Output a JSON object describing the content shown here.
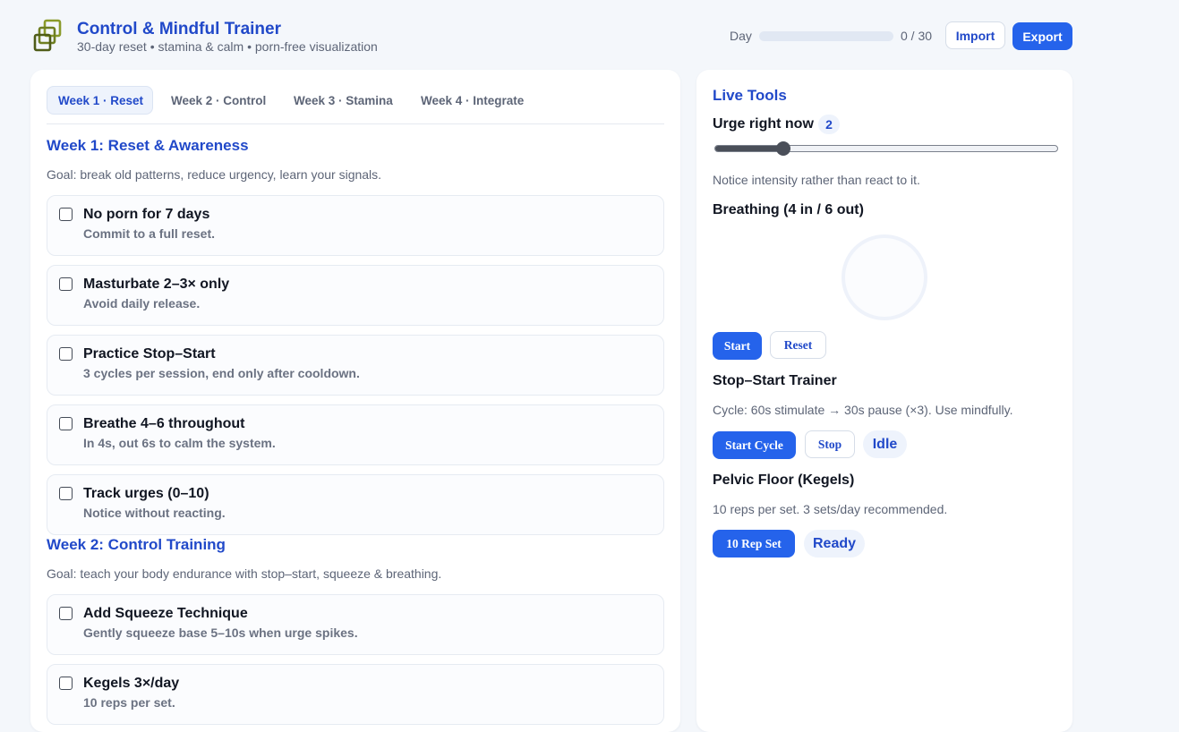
{
  "header": {
    "title": "Control & Mindful Trainer",
    "subtitle": "30-day reset • stamina & calm • porn-free visualization",
    "day_label": "Day",
    "day_count": "0 / 30",
    "day_progress": 0,
    "import_label": "Import",
    "export_label": "Export",
    "logo_icon": "layered-squares-icon"
  },
  "tabs": [
    {
      "label": "Week 1 · Reset",
      "active": true
    },
    {
      "label": "Week 2 · Control",
      "active": false
    },
    {
      "label": "Week 3 · Stamina",
      "active": false
    },
    {
      "label": "Week 4 · Integrate",
      "active": false
    }
  ],
  "weeks": [
    {
      "title": "Week 1: Reset & Awareness",
      "goal": "Goal: break old patterns, reduce urgency, learn your signals.",
      "tasks": [
        {
          "title": "No porn for 7 days",
          "desc": "Commit to a full reset.",
          "checked": false
        },
        {
          "title": "Masturbate 2–3× only",
          "desc": "Avoid daily release.",
          "checked": false
        },
        {
          "title": "Practice Stop–Start",
          "desc": "3 cycles per session, end only after cooldown.",
          "checked": false
        },
        {
          "title": "Breathe 4–6 throughout",
          "desc": "In 4s, out 6s to calm the system.",
          "checked": false
        },
        {
          "title": "Track urges (0–10)",
          "desc": "Notice without reacting.",
          "checked": false
        }
      ]
    },
    {
      "title": "Week 2: Control Training",
      "goal": "Goal: teach your body endurance with stop–start, squeeze & breathing.",
      "tasks": [
        {
          "title": "Add Squeeze Technique",
          "desc": "Gently squeeze base 5–10s when urge spikes.",
          "checked": false
        },
        {
          "title": "Kegels 3×/day",
          "desc": "10 reps per set.",
          "checked": false
        }
      ]
    }
  ],
  "tools": {
    "title": "Live Tools",
    "urge": {
      "label": "Urge right now",
      "value": "2",
      "slider_fraction": 0.2,
      "hint": "Notice intensity rather than react to it."
    },
    "breathing": {
      "label": "Breathing (4 in / 6 out)",
      "start_label": "Start",
      "reset_label": "Reset"
    },
    "stop_start": {
      "label": "Stop–Start Trainer",
      "desc": "Cycle: 60s stimulate → 30s pause (×3). Use mindfully.",
      "start_label": "Start Cycle",
      "stop_label": "Stop",
      "status": "Idle"
    },
    "kegels": {
      "label": "Pelvic Floor (Kegels)",
      "desc": "10 reps per set. 3 sets/day recommended.",
      "button_label": "10 Rep Set",
      "status": "Ready"
    }
  },
  "colors": {
    "accent": "#2563eb",
    "heading": "#2149c9",
    "logo": "#8a9a2a"
  }
}
